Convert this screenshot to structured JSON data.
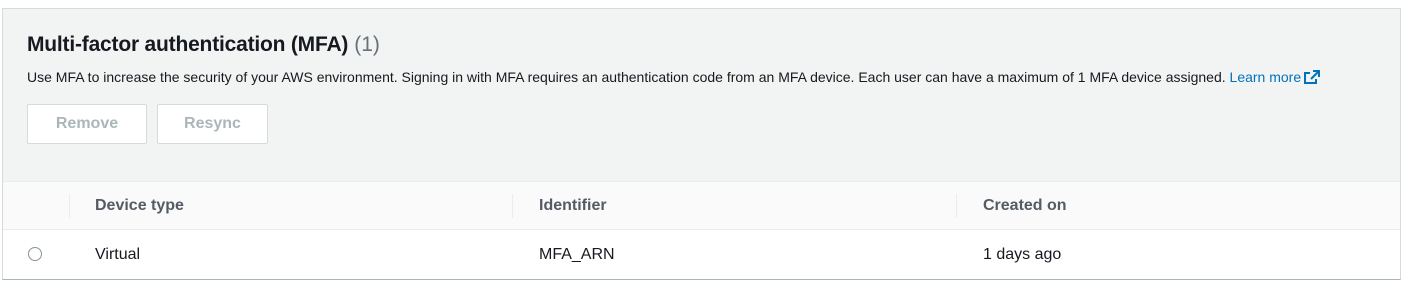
{
  "section": {
    "title": "Multi-factor authentication (MFA)",
    "count": "(1)",
    "description": "Use MFA to increase the security of your AWS environment. Signing in with MFA requires an authentication code from an MFA device. Each user can have a maximum of 1 MFA device assigned.",
    "learn_more": "Learn more",
    "learn_more_icon": "external-link-icon"
  },
  "actions": {
    "remove_label": "Remove",
    "resync_label": "Resync"
  },
  "table": {
    "columns": [
      "Device type",
      "Identifier",
      "Created on"
    ],
    "rows": [
      {
        "device_type": "Virtual",
        "identifier": "MFA_ARN",
        "created_on": "1 days ago"
      }
    ]
  },
  "colors": {
    "link": "#0073bb",
    "header_bg": "#f2f3f3",
    "disabled_text": "#aab7b8"
  }
}
